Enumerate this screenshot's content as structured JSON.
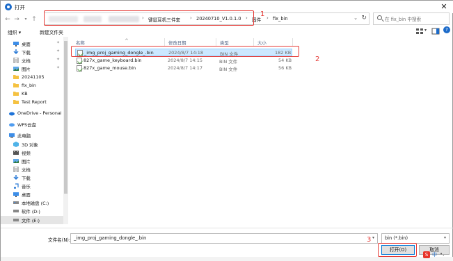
{
  "window": {
    "title": "打开"
  },
  "address": {
    "crumbs": [
      "键鼠耳机三件套",
      "20240710_V1.0.1.0",
      "固件",
      "fix_bin"
    ]
  },
  "search": {
    "placeholder": "在 fix_bin 中搜索"
  },
  "toolbar": {
    "organize": "组织 ▾",
    "new_folder": "新建文件夹"
  },
  "nav": {
    "quick_access": [
      {
        "label": "桌面",
        "icon": "desktop-icon"
      },
      {
        "label": "下载",
        "icon": "download-icon"
      },
      {
        "label": "文档",
        "icon": "document-icon"
      },
      {
        "label": "图片",
        "icon": "picture-icon"
      },
      {
        "label": "20241105",
        "icon": "folder-icon"
      },
      {
        "label": "fix_bin",
        "icon": "folder-icon"
      },
      {
        "label": "KB",
        "icon": "folder-icon"
      },
      {
        "label": "Test Report",
        "icon": "folder-icon"
      }
    ],
    "onedrive": "OneDrive - Personal",
    "wps": "WPS云盘",
    "this_pc": "此电脑",
    "pc_items": [
      {
        "label": "3D 对象",
        "icon": "3d-objects-icon"
      },
      {
        "label": "视频",
        "icon": "video-icon"
      },
      {
        "label": "图片",
        "icon": "picture-icon"
      },
      {
        "label": "文档",
        "icon": "document-icon"
      },
      {
        "label": "下载",
        "icon": "download-icon"
      },
      {
        "label": "音乐",
        "icon": "music-icon"
      },
      {
        "label": "桌面",
        "icon": "desktop-icon"
      },
      {
        "label": "本地磁盘 (C:)",
        "icon": "drive-icon"
      },
      {
        "label": "软件 (D:)",
        "icon": "drive-icon"
      },
      {
        "label": "文件 (E:)",
        "icon": "drive-icon"
      }
    ]
  },
  "columns": {
    "name": "名称",
    "date": "修改日期",
    "type": "类型",
    "size": "大小"
  },
  "files": [
    {
      "name": "_img_proj_gaming_dongle_.bin",
      "date": "2024/8/7 14:18",
      "type": "BIN 文件",
      "size": "182 KB"
    },
    {
      "name": "827x_game_keyboard.bin",
      "date": "2024/8/7 14:15",
      "type": "BIN 文件",
      "size": "54 KB"
    },
    {
      "name": "827x_game_mouse.bin",
      "date": "2024/8/7 14:17",
      "type": "BIN 文件",
      "size": "56 KB"
    }
  ],
  "bottom": {
    "filename_label": "文件名(N):",
    "filename_value": "_img_proj_gaming_dongle_.bin",
    "filetype": "bin (*.bin)",
    "open": "打开(O)",
    "cancel": "取消"
  },
  "annotations": [
    "1",
    "2",
    "3"
  ],
  "colors": {
    "annotation": "#e53935",
    "selection": "#cce8ff",
    "folder": "#f5c242"
  }
}
